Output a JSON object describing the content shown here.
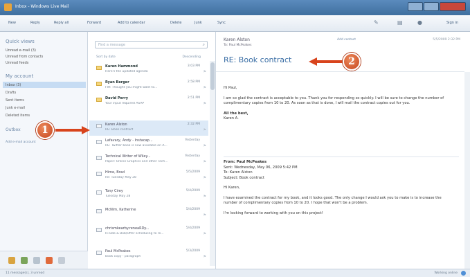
{
  "window": {
    "title": "Inbox - Windows Live Mail"
  },
  "toolbar": {
    "items": [
      "New",
      "Reply",
      "Reply all",
      "Forward",
      "Add to calendar",
      "Delete",
      "Junk",
      "Sync"
    ],
    "sign_in": "Sign in"
  },
  "sidebar": {
    "quick_views_header": "Quick views",
    "quick_views": [
      "Unread e-mail (3)",
      "Unread from contacts",
      "Unread feeds"
    ],
    "account_header": "My account",
    "folders": [
      "Inbox (3)",
      "Drafts",
      "Sent items",
      "Junk e-mail",
      "Deleted items"
    ],
    "outbox": "Outbox",
    "add_account": "Add e-mail account"
  },
  "list": {
    "search_placeholder": "Find a message",
    "sort_label": "Sort by date",
    "sort_order": "Descending",
    "messages": [
      {
        "from": "Karen Hammond",
        "subject": "Here's the updated agenda",
        "date": "3:03 PM",
        "unread": true
      },
      {
        "from": "Ryan Berger",
        "subject": "FW: Thought you might want to...",
        "date": "2:58 PM",
        "unread": true
      },
      {
        "from": "David Perry",
        "subject": "Your input required ASAP",
        "date": "2:51 PM",
        "unread": true
      },
      {
        "from": "Karen Alston",
        "subject": "RE: Book contract",
        "date": "2:32 PM",
        "unread": false
      },
      {
        "from": "Lafavary, Andy - Instacap...",
        "subject": "RE: Twitter book is now available on A...",
        "date": "Yesterday",
        "unread": false
      },
      {
        "from": "Technical Writer of Wiley...",
        "subject": "Paper: Online Graphics and other Tech...",
        "date": "Yesterday",
        "unread": false
      },
      {
        "from": "Hime, Brad",
        "subject": "Re: Tuesday May 28",
        "date": "5/5/2009",
        "unread": false
      },
      {
        "from": "Tony Cirey",
        "subject": "Tuesday May 28",
        "date": "5/4/2009",
        "unread": false
      },
      {
        "from": "McNim, Katherine",
        "subject": "",
        "date": "5/4/2009",
        "unread": false
      },
      {
        "from": "chrismkearby.reneaRDy...",
        "subject": "Hi Bob & Bob/Offer scheduling to re...",
        "date": "5/4/2009",
        "unread": false
      },
      {
        "from": "Paul McPeakes",
        "subject": "Book copy - paragraph",
        "date": "5/3/2009",
        "unread": false
      }
    ]
  },
  "reading": {
    "from": "Karen Alston",
    "to": "To: Paul McPeakes",
    "add_contact": "Add contact",
    "date": "5/5/2009 2:32 PM",
    "subject": "RE: Book contract",
    "greeting": "Hi Paul,",
    "body": "I am so glad the contract is acceptable to you. Thank you for responding so quickly. I will be sure to change the number of complimentary copies from 10 to 20. As soon as that is done, I will mail the contract copies out for you.",
    "closing": "All the best,",
    "signature": "Karen A.",
    "quote_from": "From: Paul McPeakes",
    "quote_sent": "Sent: Wednesday, May 06, 2009 5:42 PM",
    "quote_to": "To: Karen Alston",
    "quote_subject": "Subject: Book contract",
    "quote_greeting": "Hi Karen,",
    "quote_body": "I have examined the contract for my book, and it looks good. The only change I would ask you to make is to increase the number of complimentary copies from 10 to 20. I hope that won't be a problem.",
    "quote_closing": "I'm looking forward to working with you on this project!"
  },
  "status": {
    "left": "11 message(s), 3 unread",
    "right": "Working online"
  },
  "callouts": {
    "one": "1",
    "two": "2"
  },
  "colors": {
    "callout": "#d8441c",
    "accent": "#3a6ea5"
  }
}
